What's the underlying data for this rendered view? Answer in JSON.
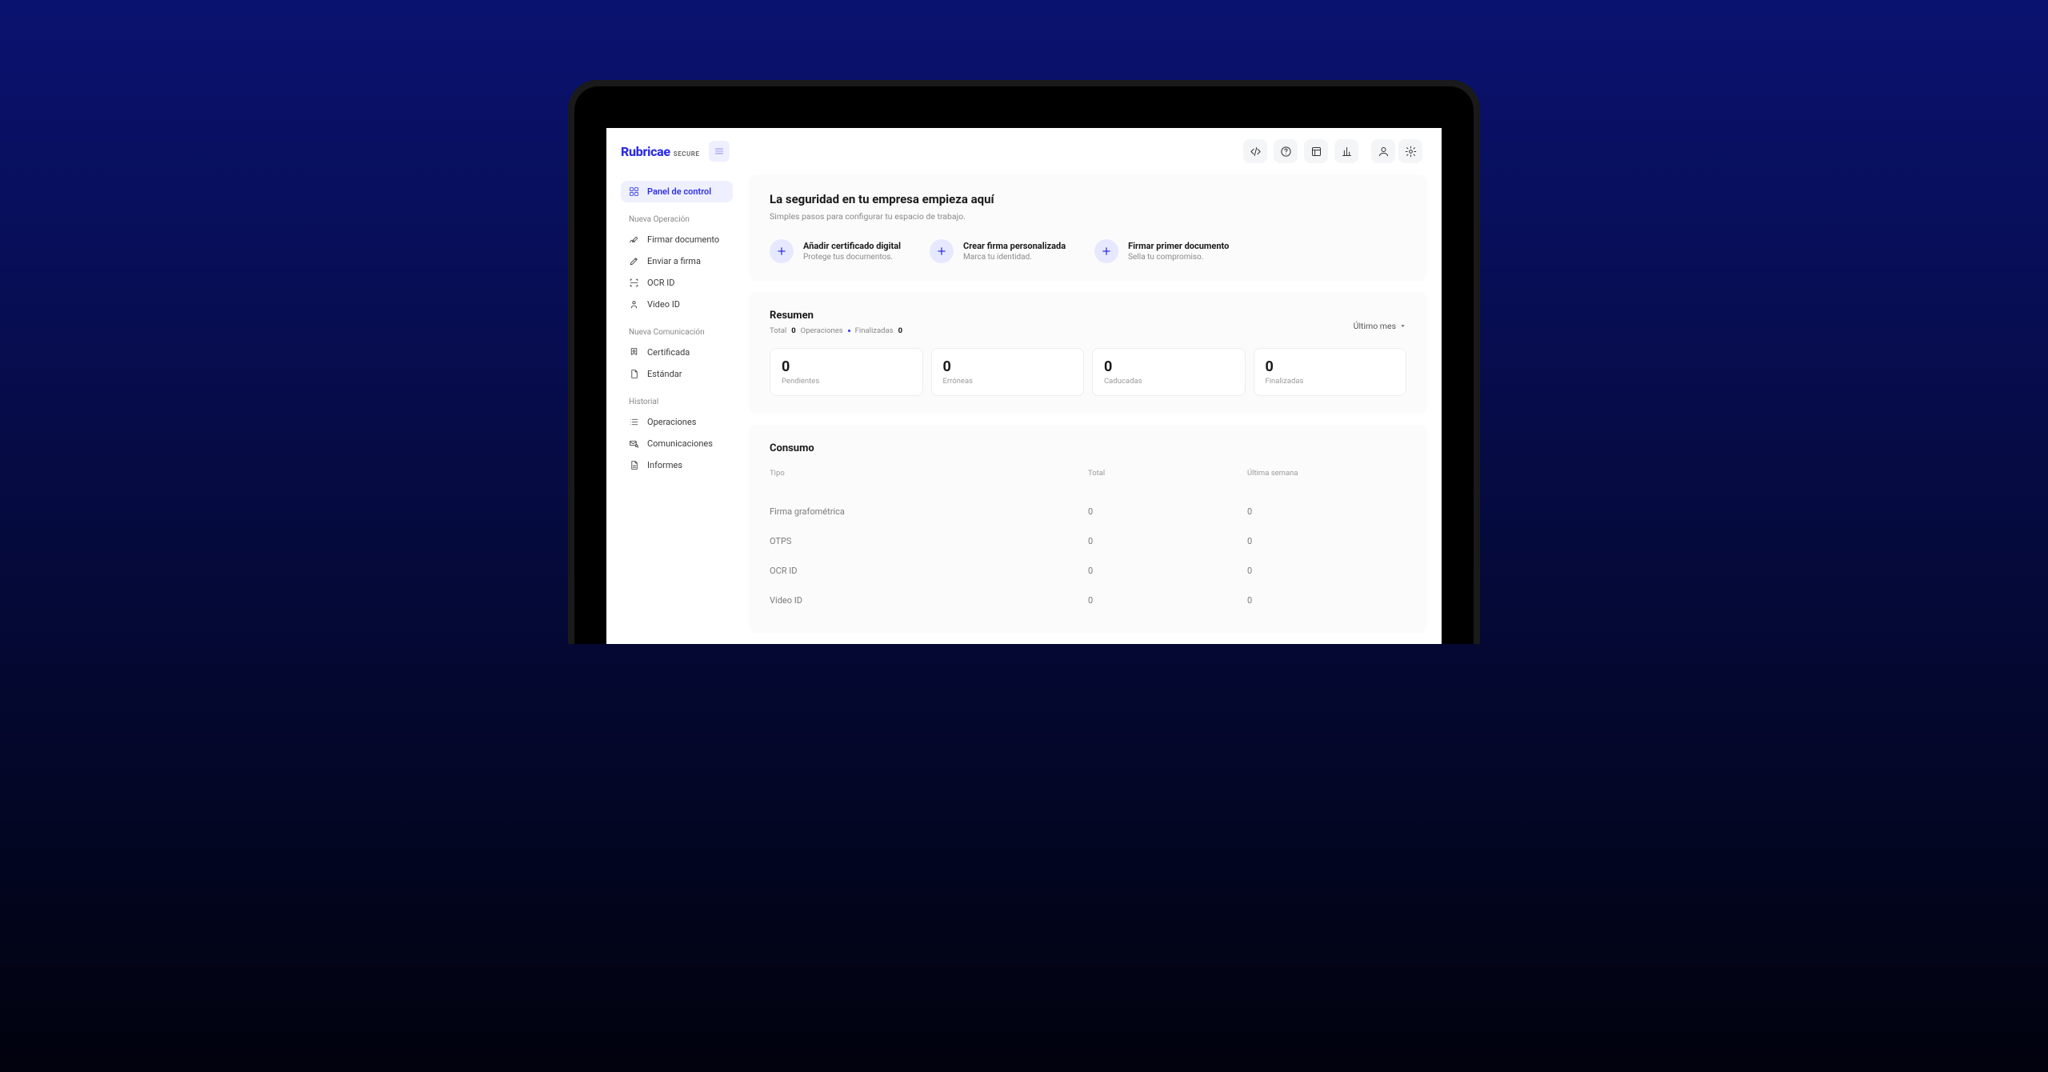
{
  "brand": {
    "name": "Rubricae",
    "suffix": "SECURE"
  },
  "sidebar": {
    "dashboard": "Panel de control",
    "sections": [
      {
        "label": "Nueva Operación",
        "items": [
          {
            "label": "Firmar documento"
          },
          {
            "label": "Enviar a firma"
          },
          {
            "label": "OCR ID"
          },
          {
            "label": "Video ID"
          }
        ]
      },
      {
        "label": "Nueva Comunicación",
        "items": [
          {
            "label": "Certificada"
          },
          {
            "label": "Estándar"
          }
        ]
      },
      {
        "label": "Historial",
        "items": [
          {
            "label": "Operaciones"
          },
          {
            "label": "Comunicaciones"
          },
          {
            "label": "Informes"
          }
        ]
      }
    ]
  },
  "onboard": {
    "title": "La seguridad en tu empresa empieza aquí",
    "subtitle": "Simples pasos para configurar tu espacio de trabajo.",
    "actions": [
      {
        "title": "Añadir certificado digital",
        "sub": "Protege tus documentos."
      },
      {
        "title": "Crear firma personalizada",
        "sub": "Marca tu identidad."
      },
      {
        "title": "Firmar primer documento",
        "sub": "Sella tu compromiso."
      }
    ]
  },
  "summary": {
    "title": "Resumen",
    "totalLabel": "Total",
    "totalValue": "0",
    "totalSuffix": "Operaciones",
    "finishedLabel": "Finalizadas",
    "finishedValue": "0",
    "period": "Último mes",
    "stats": [
      {
        "value": "0",
        "label": "Pendientes"
      },
      {
        "value": "0",
        "label": "Erróneas"
      },
      {
        "value": "0",
        "label": "Caducadas"
      },
      {
        "value": "0",
        "label": "Finalizadas"
      }
    ]
  },
  "consumo": {
    "title": "Consumo",
    "headers": {
      "type": "Tipo",
      "total": "Total",
      "week": "Última semana"
    },
    "rows": [
      {
        "type": "Firma grafométrica",
        "total": "0",
        "week": "0"
      },
      {
        "type": "OTPS",
        "total": "0",
        "week": "0"
      },
      {
        "type": "OCR ID",
        "total": "0",
        "week": "0"
      },
      {
        "type": "Vídeo ID",
        "total": "0",
        "week": "0"
      }
    ]
  }
}
